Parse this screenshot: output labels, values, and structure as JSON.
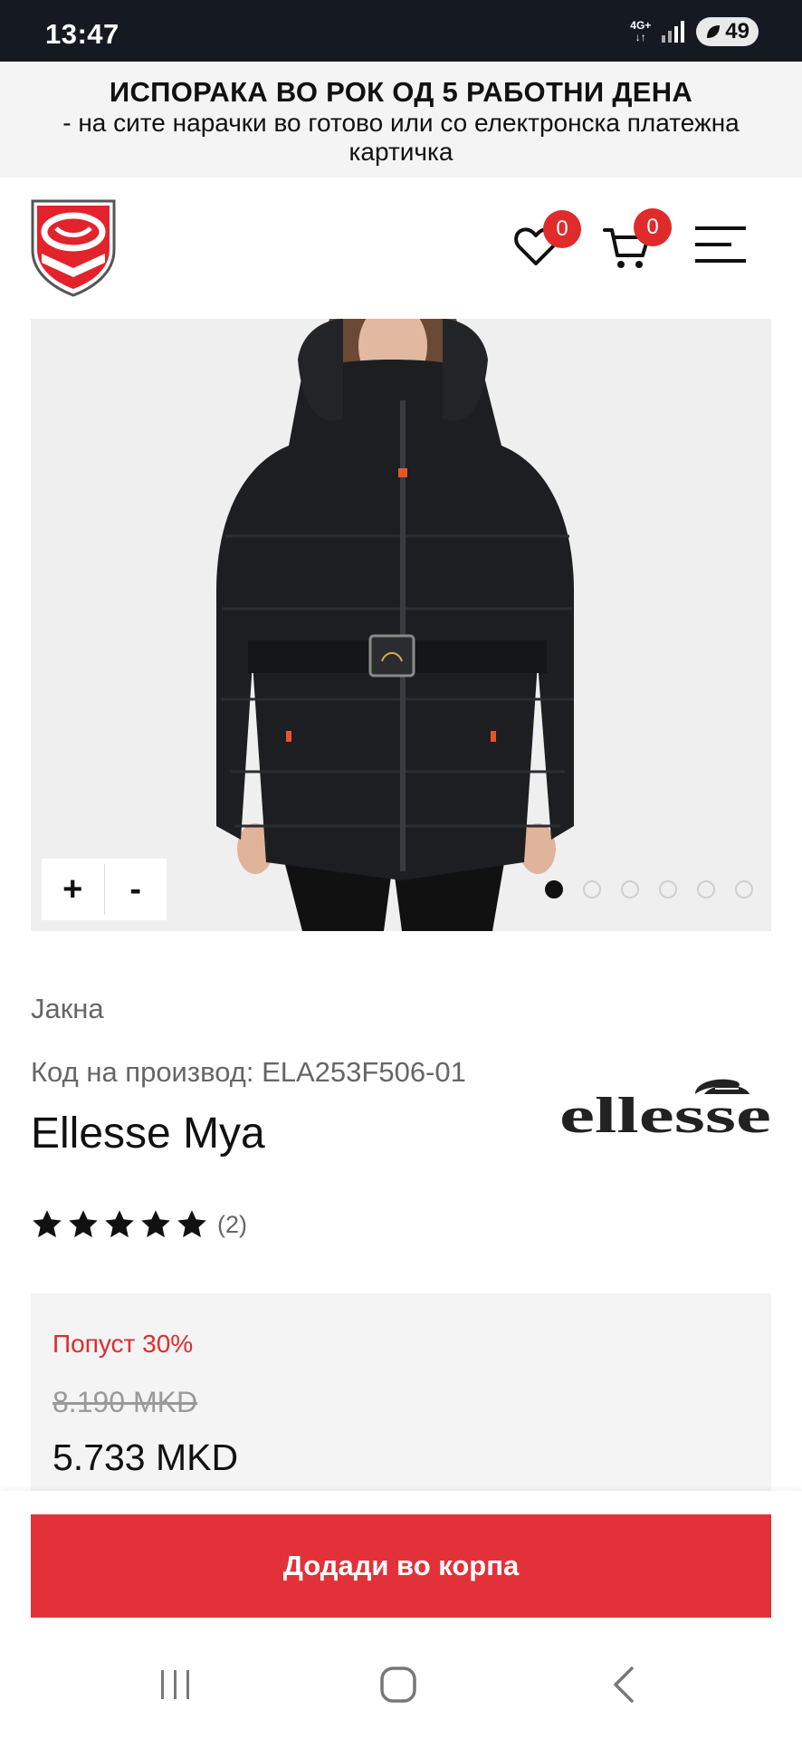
{
  "status_bar": {
    "time": "13:47",
    "network": "4G+",
    "battery": "49"
  },
  "announcement": {
    "title": "ИСПОРАКА ВО РОК ОД 5 РАБОТНИ ДЕНА",
    "subtitle": "- на сите нарачки во готово или со електронска платежна картичка"
  },
  "header": {
    "wishlist_count": "0",
    "cart_count": "0"
  },
  "gallery": {
    "zoom_in": "+",
    "zoom_out": "-",
    "slide_count": 6,
    "active_slide": 1
  },
  "product": {
    "category": "Јакна",
    "code": "Код на производ: ELA253F506-01",
    "name": "Ellesse Mya",
    "brand": "ellesse",
    "rating_stars": 5,
    "rating_count": "(2)"
  },
  "price": {
    "discount": "Попуст 30%",
    "old_price": "8.190 MKD",
    "new_price": "5.733 MKD"
  },
  "cta": {
    "add_to_cart": "Додади во корпа"
  },
  "colors": {
    "accent_red": "#e3313a",
    "status_bar_bg": "#151a22",
    "panel_bg": "#f4f4f4"
  }
}
